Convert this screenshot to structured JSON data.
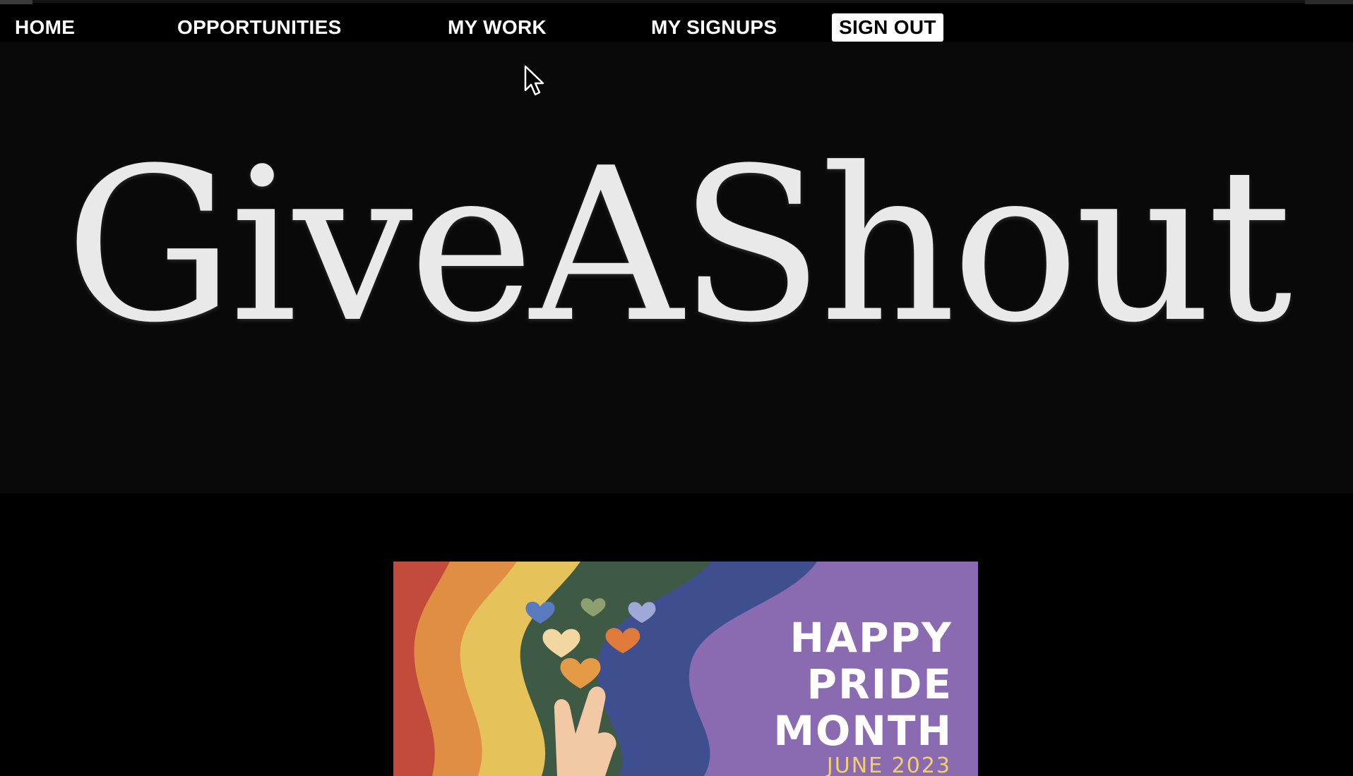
{
  "nav": {
    "items": [
      {
        "label": "HOME"
      },
      {
        "label": "OPPORTUNITIES"
      },
      {
        "label": "MY WORK"
      },
      {
        "label": "MY SIGNUPS"
      }
    ],
    "sign_out_label": "SIGN OUT"
  },
  "hero": {
    "title": "GiveAShout"
  },
  "banner": {
    "line1": "HAPPY",
    "line2": "PRIDE",
    "line3": "MONTH",
    "date": "JUNE 2023"
  },
  "colors": {
    "background": "#000000",
    "hero_background": "#090909",
    "nav_text": "#ffffff",
    "banner_purple": "#8a6ab0",
    "banner_date": "#f4d06a"
  },
  "icons": [
    "mouse-pointer-icon",
    "peace-hand-icon",
    "heart-icon"
  ]
}
